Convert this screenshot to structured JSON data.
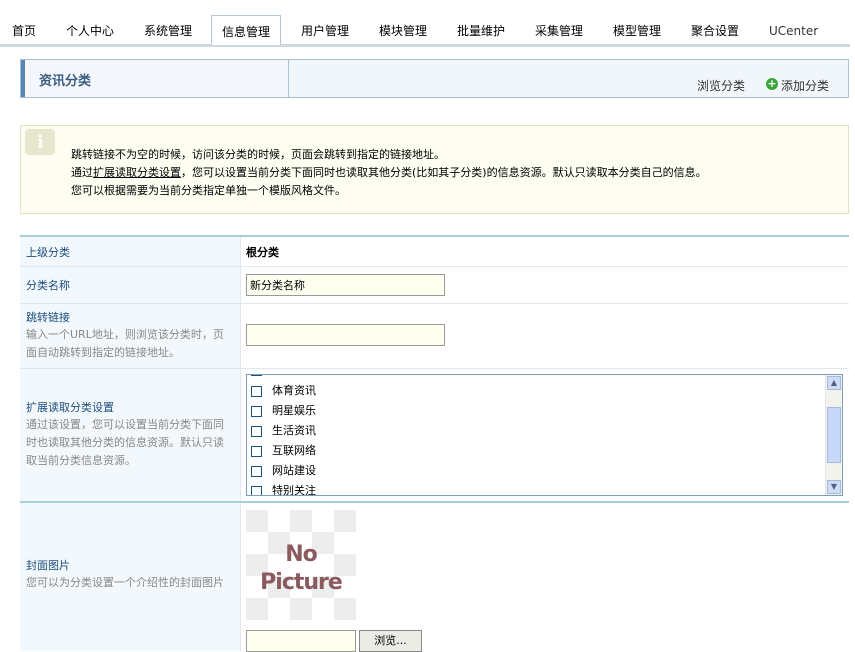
{
  "nav": {
    "items": [
      "首页",
      "个人中心",
      "系统管理",
      "信息管理",
      "用户管理",
      "模块管理",
      "批量维护",
      "采集管理",
      "模型管理",
      "聚合设置",
      "UCenter"
    ],
    "active": "信息管理"
  },
  "header": {
    "title": "资讯分类",
    "browse_label": "浏览分类",
    "add_label": "添加分类"
  },
  "tip": {
    "line1": "跳转链接不为空的时候，访问该分类的时候，页面会跳转到指定的链接地址。",
    "line2_prefix": "通过",
    "line2_link": "扩展读取分类设置",
    "line2_suffix": "，您可以设置当前分类下面同时也读取其他分类(比如其子分类)的信息资源。默认只读取本分类自己的信息。",
    "line3": "您可以根据需要为当前分类指定单独一个模版风格文件。"
  },
  "form": {
    "parent": {
      "label": "上级分类",
      "value": "根分类"
    },
    "name": {
      "label": "分类名称",
      "value": "新分类名称"
    },
    "redirect": {
      "label": "跳转链接",
      "desc": "输入一个URL地址，则浏览该分类时，页面自动跳转到指定的链接地址。",
      "value": ""
    },
    "extend": {
      "label": "扩展读取分类设置",
      "desc": "通过该设置，您可以设置当前分类下面同时也读取其他分类的信息资源。默认只读取当前分类信息资源。",
      "options": [
        "体育资讯",
        "明星娱乐",
        "生活资讯",
        "互联网络",
        "网站建设",
        "特别关注"
      ]
    },
    "cover": {
      "label": "封面图片",
      "desc": "您可以为分类设置一个介绍性的封面图片",
      "placeholder_line1": "No",
      "placeholder_line2": "Picture",
      "browse_button": "浏览..."
    }
  }
}
